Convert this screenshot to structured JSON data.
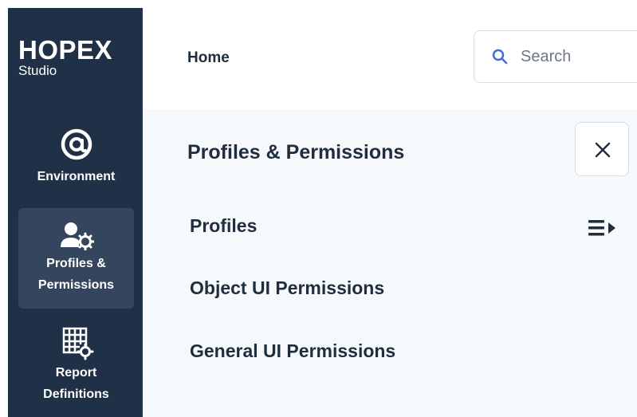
{
  "brand": {
    "name": "HOPEX",
    "subtitle": "Studio"
  },
  "sidebar": {
    "items": [
      {
        "label": "Environment",
        "icon": "at-sign-icon",
        "active": false
      },
      {
        "label_line1": "Profiles &",
        "label_line2": "Permissions",
        "icon": "user-gear-icon",
        "active": true
      },
      {
        "label_line1": "Report",
        "label_line2": "Definitions",
        "icon": "grid-gear-icon",
        "active": false
      }
    ]
  },
  "header": {
    "title": "Home",
    "search": {
      "placeholder": "Search",
      "value": ""
    }
  },
  "panel": {
    "title": "Profiles & Permissions",
    "items": [
      {
        "label": "Profiles"
      },
      {
        "label": "Object UI Permissions"
      },
      {
        "label": "General UI Permissions"
      }
    ]
  },
  "colors": {
    "sidebar_bg": "#1f3047",
    "sidebar_active": "#34455d",
    "panel_bg": "#f6f9fc",
    "text_dark": "#1f2d3d",
    "search_icon": "#3d6fd8"
  }
}
